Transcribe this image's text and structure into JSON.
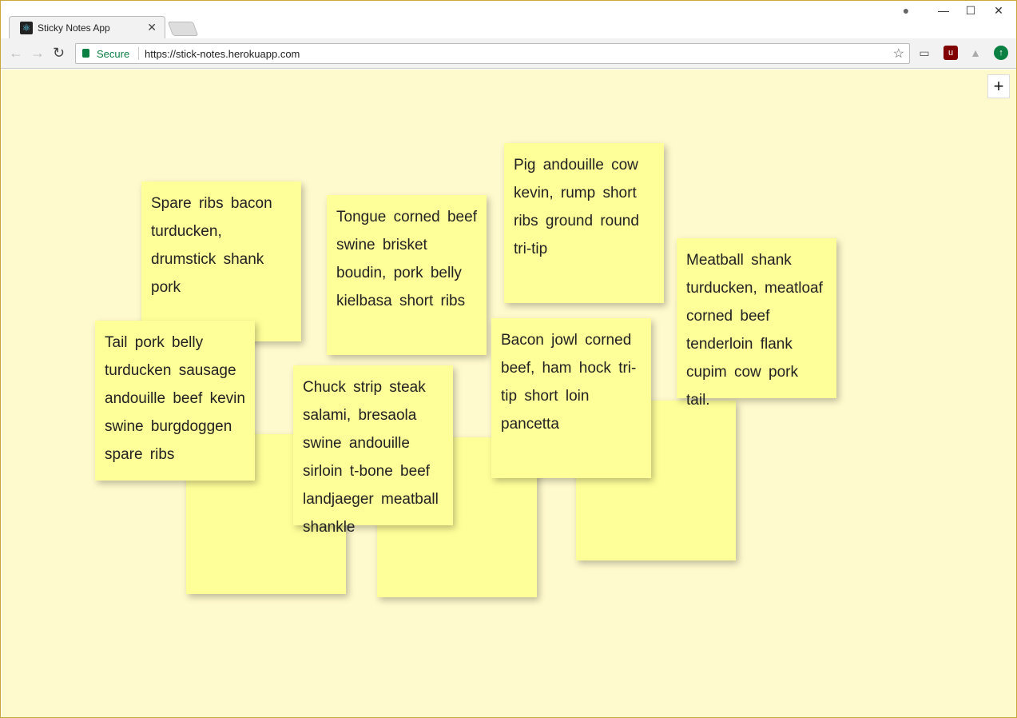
{
  "browser": {
    "tab_title": "Sticky Notes App",
    "secure_label": "Secure",
    "url": "https://stick-notes.herokuapp.com"
  },
  "app": {
    "add_label": "+"
  },
  "notes": [
    {
      "text": ""
    },
    {
      "text": ""
    },
    {
      "text": ""
    },
    {
      "text": "Spare ribs bacon turducken, drumstick shank pork"
    },
    {
      "text": "Tongue corned beef swine brisket boudin, pork belly kielbasa short ribs"
    },
    {
      "text": "Pig andouille cow kevin, rump short ribs ground round tri-tip"
    },
    {
      "text": "Meatball shank turducken, meatloaf corned beef tenderloin flank cupim cow pork tail."
    },
    {
      "text": "Tail pork belly turducken sausage andouille beef kevin swine burgdoggen spare ribs"
    },
    {
      "text": "Chuck strip steak salami, bresaola swine andouille sirloin t-bone beef landjaeger meatball shankle"
    },
    {
      "text": "Bacon jowl corned beef, ham hock tri-tip short loin pancetta"
    }
  ]
}
